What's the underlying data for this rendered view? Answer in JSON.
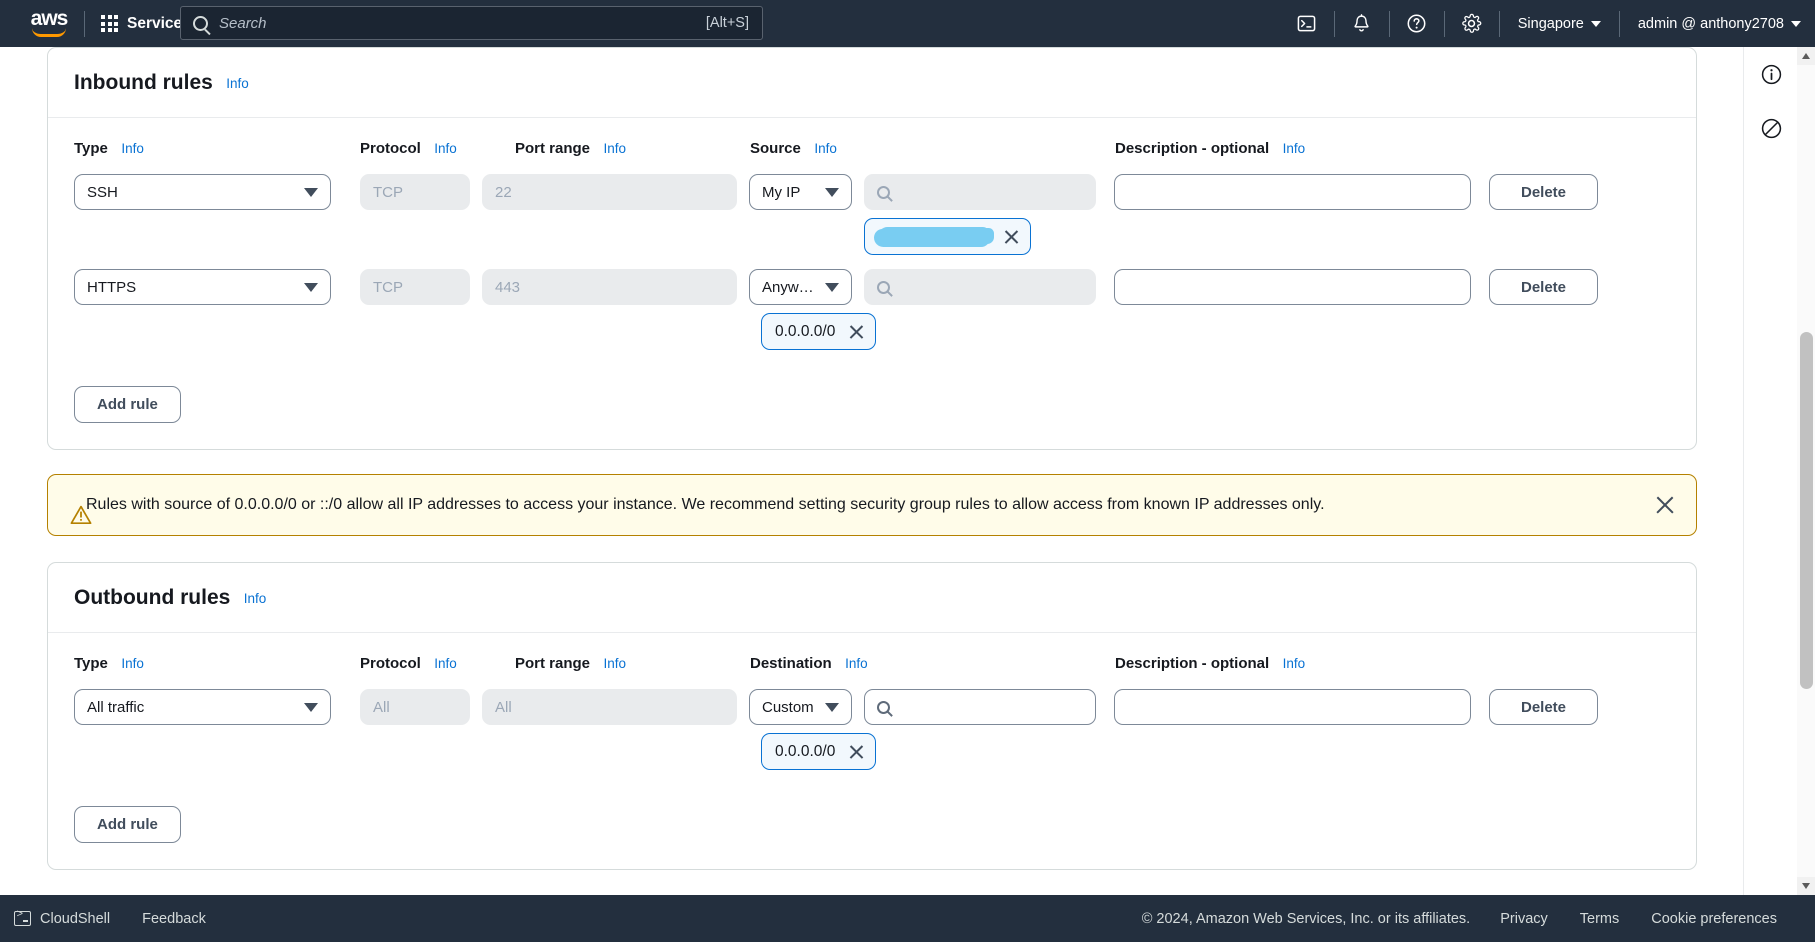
{
  "topnav": {
    "logo_alt": "aws",
    "services_label": "Services",
    "search_placeholder": "Search",
    "search_hint": "[Alt+S]",
    "icons": [
      "cloudshell-icon",
      "bell-icon",
      "help-icon",
      "gear-icon"
    ],
    "region": "Singapore",
    "account": "admin @ anthony2708"
  },
  "inbound": {
    "title": "Inbound rules",
    "info_label": "Info",
    "columns": {
      "type": "Type",
      "protocol": "Protocol",
      "port_range": "Port range",
      "source": "Source",
      "description": "Description - optional"
    },
    "rows": [
      {
        "type": "SSH",
        "protocol": "TCP",
        "port_range": "22",
        "source_select": "My IP",
        "source_search_value": "",
        "token_label": "",
        "token_redacted": true,
        "description": "",
        "delete_label": "Delete"
      },
      {
        "type": "HTTPS",
        "protocol": "TCP",
        "port_range": "443",
        "source_select": "Anyw…",
        "source_search_value": "",
        "token_label": "0.0.0.0/0",
        "token_redacted": false,
        "description": "",
        "delete_label": "Delete"
      }
    ],
    "add_rule_label": "Add rule"
  },
  "alert": {
    "icon": "warning-triangle-icon",
    "text": "Rules with source of 0.0.0.0/0 or ::/0 allow all IP addresses to access your instance. We recommend setting security group rules to allow access from known IP addresses only.",
    "dismiss_icon": "close-icon",
    "border_color": "#b58100",
    "background_color": "#fffce9"
  },
  "outbound": {
    "title": "Outbound rules",
    "info_label": "Info",
    "columns": {
      "type": "Type",
      "protocol": "Protocol",
      "port_range": "Port range",
      "destination": "Destination",
      "description": "Description - optional"
    },
    "rows": [
      {
        "type": "All traffic",
        "protocol": "All",
        "port_range": "All",
        "destination_select": "Custom",
        "destination_search_value": "",
        "token_label": "0.0.0.0/0",
        "description": "",
        "delete_label": "Delete"
      }
    ],
    "add_rule_label": "Add rule"
  },
  "help_rail": {
    "info_icon": "info-circle-icon",
    "shortcuts_icon": "contact-support-icon"
  },
  "footer": {
    "cloudshell_label": "CloudShell",
    "feedback_label": "Feedback",
    "copyright": "© 2024, Amazon Web Services, Inc. or its affiliates.",
    "privacy_label": "Privacy",
    "terms_label": "Terms",
    "cookie_label": "Cookie preferences"
  },
  "theme": {
    "nav_background": "#232f3e",
    "accent_link": "#0972d3",
    "aws_orange": "#ff9900",
    "token_border": "#0972d3",
    "redaction_color": "#79cdf2"
  }
}
